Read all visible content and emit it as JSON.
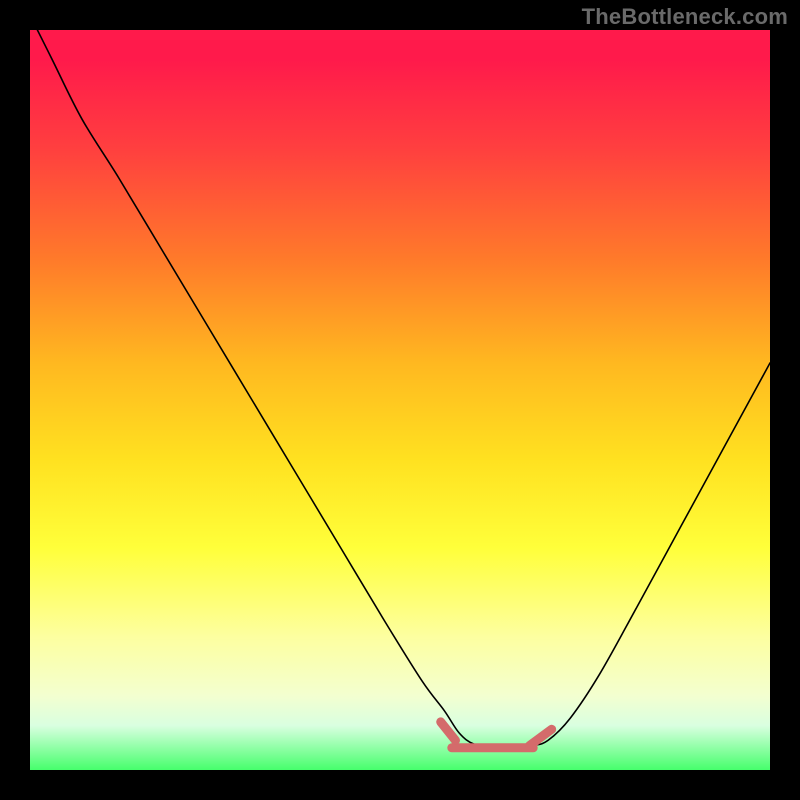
{
  "watermark": "TheBottleneck.com",
  "colors": {
    "curve": "#000000",
    "highlight": "#d46b6b",
    "frame": "#000000"
  },
  "chart_data": {
    "type": "line",
    "title": "",
    "xlabel": "",
    "ylabel": "",
    "xlim": [
      0,
      100
    ],
    "ylim": [
      0,
      100
    ],
    "grid": false,
    "legend": false,
    "series": [
      {
        "name": "bottleneck-curve",
        "x": [
          0,
          3,
          7,
          12,
          18,
          24,
          30,
          36,
          42,
          48,
          53,
          56,
          58,
          60,
          63,
          66,
          68,
          70,
          73,
          77,
          82,
          88,
          94,
          100
        ],
        "y": [
          102,
          96,
          88,
          80,
          70,
          60,
          50,
          40,
          30,
          20,
          12,
          8,
          5,
          3.5,
          3,
          3,
          3.3,
          4,
          7,
          13,
          22,
          33,
          44,
          55
        ]
      }
    ],
    "highlight": {
      "flat_range_x": [
        57,
        68
      ],
      "flat_y": 3,
      "left_tick": {
        "x": [
          55.5,
          57.5
        ],
        "y": [
          6.5,
          4
        ]
      },
      "right_tick": {
        "x": [
          67.5,
          70.5
        ],
        "y": [
          3.3,
          5.5
        ]
      }
    },
    "gradient_stops": [
      {
        "pos": 0.0,
        "color": "#ff1a4b"
      },
      {
        "pos": 0.04,
        "color": "#ff1a4b"
      },
      {
        "pos": 0.16,
        "color": "#ff3f3f"
      },
      {
        "pos": 0.31,
        "color": "#ff7a2a"
      },
      {
        "pos": 0.45,
        "color": "#ffb820"
      },
      {
        "pos": 0.58,
        "color": "#ffe120"
      },
      {
        "pos": 0.7,
        "color": "#ffff3a"
      },
      {
        "pos": 0.82,
        "color": "#fdffa0"
      },
      {
        "pos": 0.9,
        "color": "#f3ffd0"
      },
      {
        "pos": 0.94,
        "color": "#d9ffe0"
      },
      {
        "pos": 1.0,
        "color": "#46ff6c"
      }
    ]
  }
}
